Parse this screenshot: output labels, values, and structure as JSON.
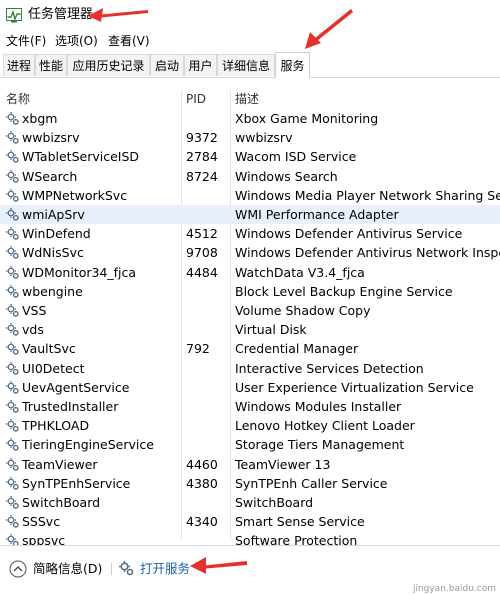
{
  "window": {
    "title": "任务管理器"
  },
  "menu": [
    "文件(F)",
    "选项(O)",
    "查看(V)"
  ],
  "tabs": [
    "进程",
    "性能",
    "应用历史记录",
    "启动",
    "用户",
    "详细信息",
    "服务"
  ],
  "active_tab": "服务",
  "columns": {
    "name": "名称",
    "pid": "PID",
    "desc": "描述"
  },
  "services": [
    {
      "name": "xbgm",
      "pid": "",
      "desc": "Xbox Game Monitoring"
    },
    {
      "name": "wwbizsrv",
      "pid": "9372",
      "desc": "wwbizsrv"
    },
    {
      "name": "WTabletServiceISD",
      "pid": "2784",
      "desc": "Wacom ISD Service"
    },
    {
      "name": "WSearch",
      "pid": "8724",
      "desc": "Windows Search"
    },
    {
      "name": "WMPNetworkSvc",
      "pid": "",
      "desc": "Windows Media Player Network Sharing Ser..."
    },
    {
      "name": "wmiApSrv",
      "pid": "",
      "desc": "WMI Performance Adapter"
    },
    {
      "name": "WinDefend",
      "pid": "4512",
      "desc": "Windows Defender Antivirus Service"
    },
    {
      "name": "WdNisSvc",
      "pid": "9708",
      "desc": "Windows Defender Antivirus Network Inspe..."
    },
    {
      "name": "WDMonitor34_fjca",
      "pid": "4484",
      "desc": "WatchData V3.4_fjca"
    },
    {
      "name": "wbengine",
      "pid": "",
      "desc": "Block Level Backup Engine Service"
    },
    {
      "name": "VSS",
      "pid": "",
      "desc": "Volume Shadow Copy"
    },
    {
      "name": "vds",
      "pid": "",
      "desc": "Virtual Disk"
    },
    {
      "name": "VaultSvc",
      "pid": "792",
      "desc": "Credential Manager"
    },
    {
      "name": "UI0Detect",
      "pid": "",
      "desc": "Interactive Services Detection"
    },
    {
      "name": "UevAgentService",
      "pid": "",
      "desc": "User Experience Virtualization Service"
    },
    {
      "name": "TrustedInstaller",
      "pid": "",
      "desc": "Windows Modules Installer"
    },
    {
      "name": "TPHKLOAD",
      "pid": "",
      "desc": "Lenovo Hotkey Client Loader"
    },
    {
      "name": "TieringEngineService",
      "pid": "",
      "desc": "Storage Tiers Management"
    },
    {
      "name": "TeamViewer",
      "pid": "4460",
      "desc": "TeamViewer 13"
    },
    {
      "name": "SynTPEnhService",
      "pid": "4380",
      "desc": "SynTPEnh Caller Service"
    },
    {
      "name": "SwitchBoard",
      "pid": "",
      "desc": "SwitchBoard"
    },
    {
      "name": "SSSvc",
      "pid": "4340",
      "desc": "Smart Sense Service"
    },
    {
      "name": "sppsvc",
      "pid": "",
      "desc": "Software Protection"
    }
  ],
  "selected_service": "wmiApSrv",
  "footer": {
    "fewer_details": "简略信息(D)",
    "open_services": "打开服务"
  },
  "watermark": "jingyan.baidu.com",
  "colors": {
    "annotation_arrow": "#e8302a",
    "selection": "#e8f1fb",
    "link": "#1a5fb4"
  },
  "icons": {
    "app": "task-manager-icon",
    "service": "gear-icon",
    "collapse": "chevron-up-circle-icon",
    "open": "services-gear-icon"
  }
}
